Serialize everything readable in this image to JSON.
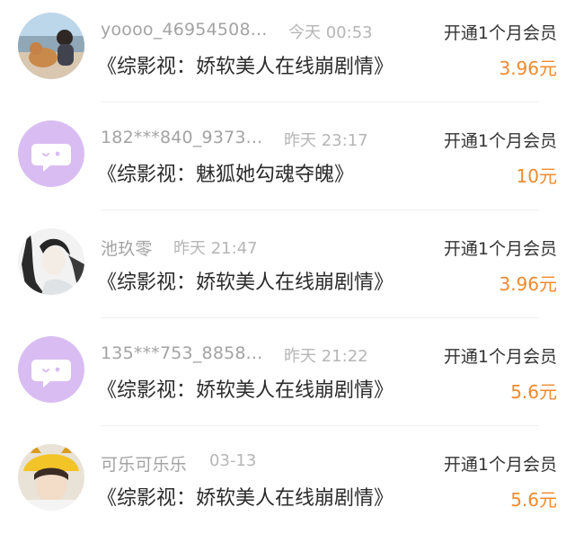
{
  "orders": [
    {
      "avatar": "photo-avatar",
      "username": "yoooo_46954508...",
      "time": "今天 00:53",
      "title": "《综影视：娇软美人在线崩剧情》",
      "plan": "开通1个月会员",
      "price": "3.96元"
    },
    {
      "avatar": "default-chat-avatar-icon",
      "username": "182***840_9373...",
      "time": "昨天 23:17",
      "title": "《综影视：魅狐她勾魂夺魄》",
      "plan": "开通1个月会员",
      "price": "10元"
    },
    {
      "avatar": "illustration-avatar",
      "username": "池玖零",
      "time": "昨天 21:47",
      "title": "《综影视：娇软美人在线崩剧情》",
      "plan": "开通1个月会员",
      "price": "3.96元"
    },
    {
      "avatar": "default-chat-avatar-icon",
      "username": "135***753_8858...",
      "time": "昨天 21:22",
      "title": "《综影视：娇软美人在线崩剧情》",
      "plan": "开通1个月会员",
      "price": "5.6元"
    },
    {
      "avatar": "photo-avatar",
      "username": "可乐可乐乐",
      "time": "03-13",
      "title": "《综影视：娇软美人在线崩剧情》",
      "plan": "开通1个月会员",
      "price": "5.6元"
    }
  ],
  "colors": {
    "price": "#f08a2c",
    "username": "#a3a3a3",
    "default_avatar_bg": "#d9bdf2"
  }
}
